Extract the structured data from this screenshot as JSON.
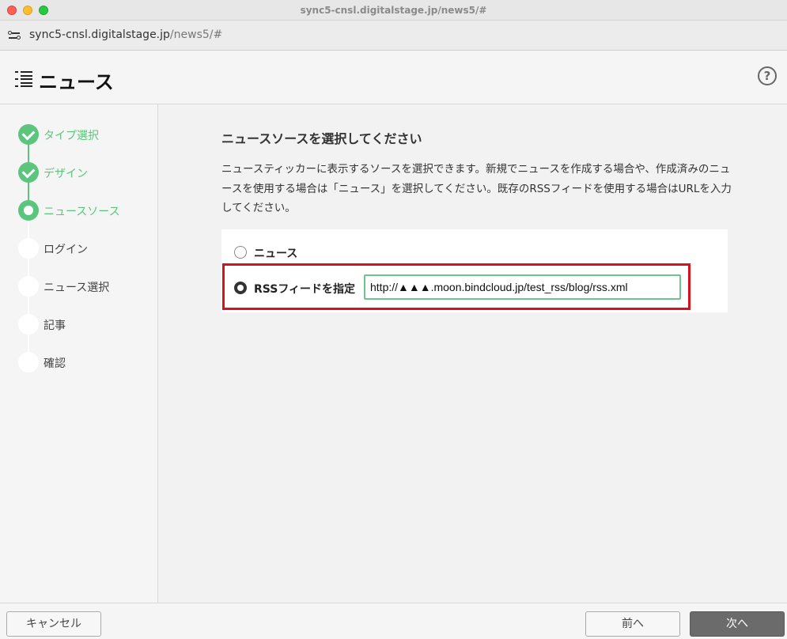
{
  "window": {
    "title": "sync5-cnsl.digitalstage.jp/news5/#"
  },
  "address_bar": {
    "host": "sync5-cnsl.digitalstage.jp",
    "path": "/news5/#"
  },
  "header": {
    "title": "ニュース",
    "help_label": "?"
  },
  "sidebar": {
    "steps": [
      {
        "label": "タイプ選択",
        "state": "done"
      },
      {
        "label": "デザイン",
        "state": "done"
      },
      {
        "label": "ニュースソース",
        "state": "current"
      },
      {
        "label": "ログイン",
        "state": "todo"
      },
      {
        "label": "ニュース選択",
        "state": "todo"
      },
      {
        "label": "記事",
        "state": "todo"
      },
      {
        "label": "確認",
        "state": "todo"
      }
    ]
  },
  "main": {
    "heading": "ニュースソースを選択してください",
    "description": "ニュースティッカーに表示するソースを選択できます。新規でニュースを作成する場合や、作成済みのニュースを使用する場合は「ニュース」を選択してください。既存のRSSフィードを使用する場合はURLを入力してください。",
    "options": [
      {
        "label": "ニュース",
        "selected": false
      },
      {
        "label": "RSSフィードを指定",
        "selected": true
      }
    ],
    "rss_url_value": "http://▲▲▲.moon.bindcloud.jp/test_rss/blog/rss.xml"
  },
  "footer": {
    "cancel_label": "キャンセル",
    "prev_label": "前へ",
    "next_label": "次へ"
  },
  "colors": {
    "accent_green": "#5cc57d",
    "highlight_red": "#d6121c",
    "primary_button": "#6b6b6b"
  }
}
